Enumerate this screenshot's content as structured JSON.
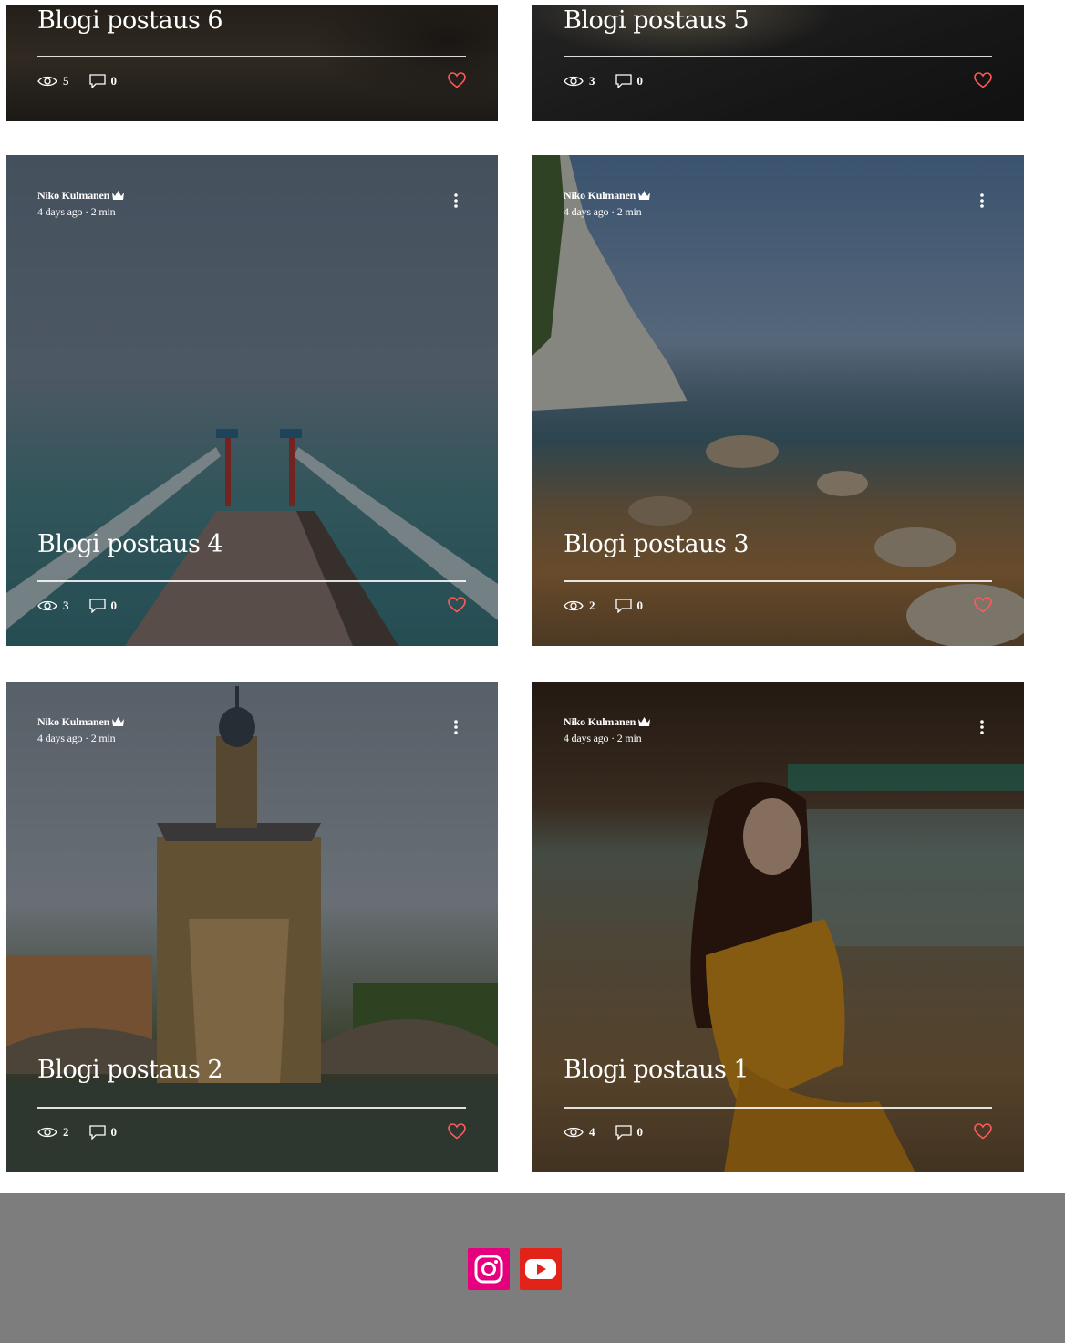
{
  "posts": [
    {
      "title": "Blogi postaus 6",
      "views": "5",
      "comments": "0"
    },
    {
      "title": "Blogi postaus 5",
      "views": "3",
      "comments": "0"
    },
    {
      "author": "Niko Kulmanen",
      "date": "4 days ago  ·  2 min",
      "title": "Blogi postaus 4",
      "views": "3",
      "comments": "0"
    },
    {
      "author": "Niko Kulmanen",
      "date": "4 days ago  ·  2 min",
      "title": "Blogi postaus 3",
      "views": "2",
      "comments": "0"
    },
    {
      "author": "Niko Kulmanen",
      "date": "4 days ago  ·  2 min",
      "title": "Blogi postaus 2",
      "views": "2",
      "comments": "0"
    },
    {
      "author": "Niko Kulmanen",
      "date": "4 days ago  ·  2 min",
      "title": "Blogi postaus 1",
      "views": "4",
      "comments": "0"
    }
  ],
  "colors": {
    "heart": "#ff5a5a",
    "footer_bg": "#7d7d7d",
    "instagram": "#e6007e",
    "youtube": "#e2231a"
  },
  "footer": {
    "social": [
      {
        "icon": "instagram-icon"
      },
      {
        "icon": "youtube-icon"
      }
    ]
  }
}
